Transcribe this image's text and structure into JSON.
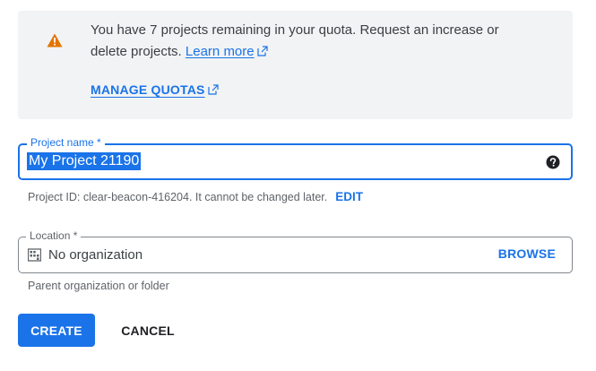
{
  "quota_notice": {
    "icon": "warning-icon",
    "message": "You have 7 projects remaining in your quota. Request an increase or delete projects.",
    "learn_more": "Learn more",
    "manage_quotas": "MANAGE QUOTAS"
  },
  "project_name": {
    "label": "Project name *",
    "value": "My Project 21190",
    "help_icon": "help-circle-icon"
  },
  "project_id": {
    "text": "Project ID: clear-beacon-416204. It cannot be changed later.",
    "edit": "EDIT"
  },
  "location": {
    "label": "Location *",
    "icon": "organization-icon",
    "value": "No organization",
    "browse": "BROWSE",
    "hint": "Parent organization or folder"
  },
  "actions": {
    "create": "CREATE",
    "cancel": "CANCEL"
  },
  "colors": {
    "accent": "#1a73e8",
    "warning": "#e37400",
    "notice_bg": "#f1f3f4"
  }
}
